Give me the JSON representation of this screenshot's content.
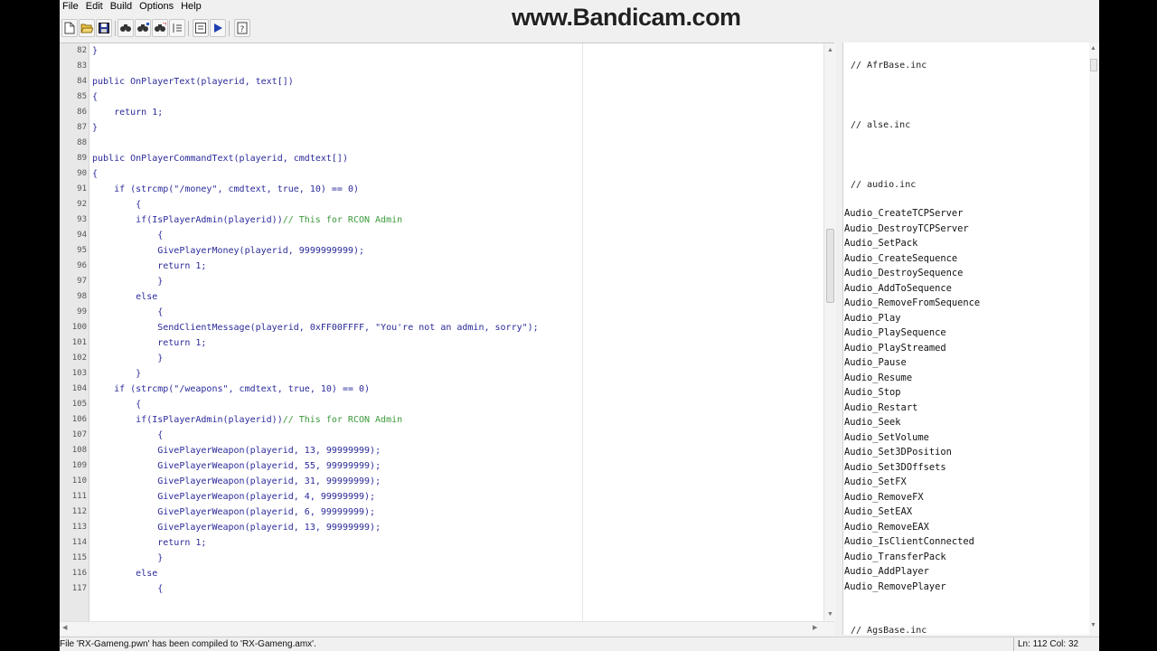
{
  "menu": [
    "File",
    "Edit",
    "Build",
    "Options",
    "Help"
  ],
  "toolbar": {
    "buttons": [
      "new-file-icon",
      "open-folder-icon",
      "save-icon",
      "find-icon",
      "find-next-icon",
      "replace-icon",
      "goto-line-icon",
      "compile-icon",
      "run-icon",
      "help-icon"
    ]
  },
  "watermark": "www.Bandicam.com",
  "editor": {
    "lines": [
      {
        "n": "82",
        "t": "}"
      },
      {
        "n": "83",
        "t": ""
      },
      {
        "n": "84",
        "t": "public OnPlayerText(playerid, text[])"
      },
      {
        "n": "85",
        "t": "{"
      },
      {
        "n": "86",
        "t": "    return 1;"
      },
      {
        "n": "87",
        "t": "}"
      },
      {
        "n": "88",
        "t": ""
      },
      {
        "n": "89",
        "t": "public OnPlayerCommandText(playerid, cmdtext[])"
      },
      {
        "n": "90",
        "t": "{"
      },
      {
        "n": "91",
        "t": "    if (strcmp(\"/money\", cmdtext, true, 10) == 0)"
      },
      {
        "n": "92",
        "t": "        {"
      },
      {
        "n": "93",
        "t": "        if(IsPlayerAdmin(playerid))",
        "c": "// This for RCON Admin"
      },
      {
        "n": "94",
        "t": "            {"
      },
      {
        "n": "95",
        "t": "            GivePlayerMoney(playerid, 9999999999);"
      },
      {
        "n": "96",
        "t": "            return 1;"
      },
      {
        "n": "97",
        "t": "            }"
      },
      {
        "n": "98",
        "t": "        else"
      },
      {
        "n": "99",
        "t": "            {"
      },
      {
        "n": "100",
        "t": "            SendClientMessage(playerid, 0xFF00FFFF, \"You're not an admin, sorry\");"
      },
      {
        "n": "101",
        "t": "            return 1;"
      },
      {
        "n": "102",
        "t": "            }"
      },
      {
        "n": "103",
        "t": "        }"
      },
      {
        "n": "104",
        "t": "    if (strcmp(\"/weapons\", cmdtext, true, 10) == 0)"
      },
      {
        "n": "105",
        "t": "        {"
      },
      {
        "n": "106",
        "t": "        if(IsPlayerAdmin(playerid))",
        "c": "// This for RCON Admin"
      },
      {
        "n": "107",
        "t": "            {"
      },
      {
        "n": "108",
        "t": "            GivePlayerWeapon(playerid, 13, 99999999);"
      },
      {
        "n": "109",
        "t": "            GivePlayerWeapon(playerid, 55, 99999999);"
      },
      {
        "n": "110",
        "t": "            GivePlayerWeapon(playerid, 31, 99999999);"
      },
      {
        "n": "111",
        "t": "            GivePlayerWeapon(playerid, 4, 99999999);"
      },
      {
        "n": "112",
        "t": "            GivePlayerWeapon(playerid, 6, 99999999);"
      },
      {
        "n": "113",
        "t": "            GivePlayerWeapon(playerid, 13, 99999999);"
      },
      {
        "n": "114",
        "t": "            return 1;"
      },
      {
        "n": "115",
        "t": "            }"
      },
      {
        "n": "116",
        "t": "        else"
      },
      {
        "n": "117",
        "t": "            {"
      }
    ]
  },
  "sidebar": {
    "includes": [
      "// AfrBase.inc",
      "// alse.inc",
      "// audio.inc",
      "// AgsBase.inc"
    ],
    "functions": [
      "Audio_CreateTCPServer",
      "Audio_DestroyTCPServer",
      "Audio_SetPack",
      "Audio_CreateSequence",
      "Audio_DestroySequence",
      "Audio_AddToSequence",
      "Audio_RemoveFromSequence",
      "Audio_Play",
      "Audio_PlaySequence",
      "Audio_PlayStreamed",
      "Audio_Pause",
      "Audio_Resume",
      "Audio_Stop",
      "Audio_Restart",
      "Audio_Seek",
      "Audio_SetVolume",
      "Audio_Set3DPosition",
      "Audio_Set3DOffsets",
      "Audio_SetFX",
      "Audio_RemoveFX",
      "Audio_SetEAX",
      "Audio_RemoveEAX",
      "Audio_IsClientConnected",
      "Audio_TransferPack",
      "Audio_AddPlayer",
      "Audio_RemovePlayer"
    ]
  },
  "status": {
    "message": "File 'RX-Gameng.pwn' has been compiled to 'RX-Gameng.amx'.",
    "position": "Ln: 112  Col: 32"
  }
}
